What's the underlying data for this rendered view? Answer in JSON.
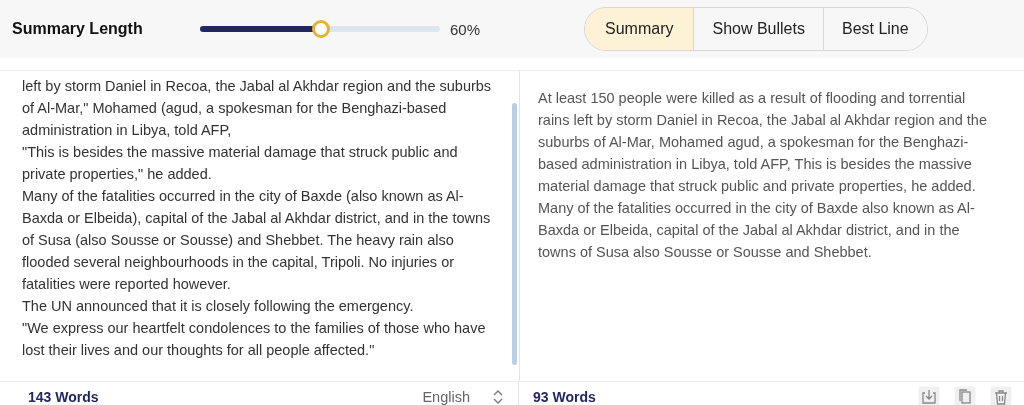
{
  "summary_length": {
    "label": "Summary Length",
    "level": 0.5,
    "reading": "60%"
  },
  "modes": [
    {
      "label": "Summary",
      "selected": true
    },
    {
      "label": "Show Bullets",
      "selected": false
    },
    {
      "label": "Best Line",
      "selected": false
    }
  ],
  "input": {
    "paragraphs": [
      "left by storm Daniel in Recoa, the Jabal al Akhdar region and the suburbs of Al-Mar,\" Mohamed (agud, a spokesman for the Benghazi-based administration in Libya, told AFP,",
      "\"This is besides the massive material damage that struck public and private properties,\" he added.",
      "Many of the fatalities occurred in the city of Baxde (also known as Al-Baxda or Elbeida), capital of the Jabal al Akhdar district, and in the towns of Susa (also Sousse or Sousse) and Shebbet. The heavy rain also flooded several neighbourhoods in the capital, Tripoli. No injuries or fatalities were reported however.",
      "The UN announced that it is closely following the emergency.",
      "\"We express our heartfelt condolences to the families of those who have lost their lives and our thoughts for all people affected.\""
    ],
    "word_count": "143 Words",
    "language": "English"
  },
  "output": {
    "text": "At least 150 people were killed as a result of flooding and torrential rains left by storm Daniel in Recoa, the Jabal al Akhdar region and the suburbs of Al-Mar, Mohamed agud, a spokesman for the Benghazi-based administration in Libya, told AFP, This is besides the massive material damage that struck public and private properties, he added. Many of the fatalities occurred in the city of Baxde also known as Al-Baxda or Elbeida, capital of the Jabal al Akhdar district, and in the towns of Susa also Sousse or Sousse and Shebbet.",
    "word_count": "93 Words"
  }
}
